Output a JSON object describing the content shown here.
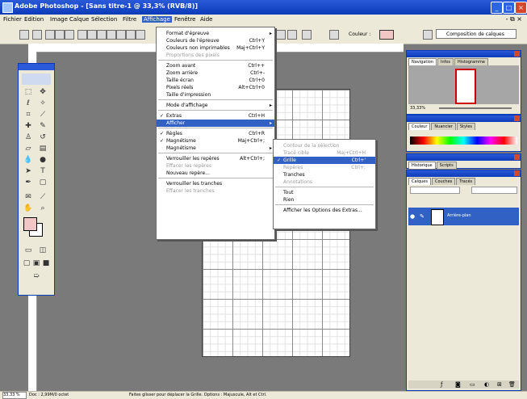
{
  "window": {
    "title": "Adobe Photoshop - [Sans titre-1 @ 33,3% (RVB/8)]"
  },
  "menubar": {
    "items": [
      "Fichier",
      "Edition",
      "Image",
      "Calque",
      "Sélection",
      "Filtre",
      "Affichage",
      "Fenêtre",
      "Aide"
    ],
    "active_index": 6
  },
  "options_bar": {
    "workspace_label": "Composition de calques",
    "fill_label": "Couleur :",
    "fill_color": "#f3c6c6"
  },
  "view_menu": {
    "items": [
      {
        "label": "Format d'épreuve",
        "shortcut": "",
        "submenu": true,
        "disabled": false,
        "checked": false
      },
      {
        "label": "Couleurs de l'épreuve",
        "shortcut": "Ctrl+Y",
        "submenu": false,
        "disabled": false,
        "checked": false
      },
      {
        "label": "Couleurs non imprimables",
        "shortcut": "Maj+Ctrl+Y",
        "submenu": false,
        "disabled": false,
        "checked": false
      },
      {
        "label": "Proportions des pixels",
        "shortcut": "",
        "submenu": false,
        "disabled": true,
        "checked": false
      },
      {
        "label": "Zoom avant",
        "shortcut": "Ctrl++",
        "submenu": false,
        "disabled": false,
        "checked": false
      },
      {
        "label": "Zoom arrière",
        "shortcut": "Ctrl+-",
        "submenu": false,
        "disabled": false,
        "checked": false
      },
      {
        "label": "Taille écran",
        "shortcut": "Ctrl+0",
        "submenu": false,
        "disabled": false,
        "checked": false
      },
      {
        "label": "Pixels réels",
        "shortcut": "Alt+Ctrl+0",
        "submenu": false,
        "disabled": false,
        "checked": false
      },
      {
        "label": "Taille d'impression",
        "shortcut": "",
        "submenu": false,
        "disabled": false,
        "checked": false
      },
      {
        "label": "Mode d'affichage",
        "shortcut": "",
        "submenu": true,
        "disabled": false,
        "checked": false
      },
      {
        "label": "Extras",
        "shortcut": "Ctrl+H",
        "submenu": false,
        "disabled": false,
        "checked": true
      },
      {
        "label": "Afficher",
        "shortcut": "",
        "submenu": true,
        "disabled": false,
        "checked": false,
        "selected": true
      },
      {
        "label": "Règles",
        "shortcut": "Ctrl+R",
        "submenu": false,
        "disabled": false,
        "checked": true
      },
      {
        "label": "Magnétisme",
        "shortcut": "Maj+Ctrl+;",
        "submenu": false,
        "disabled": false,
        "checked": true
      },
      {
        "label": "Magnétisme",
        "shortcut": "",
        "submenu": true,
        "disabled": false,
        "checked": false
      },
      {
        "label": "Verrouiller les repères",
        "shortcut": "Alt+Ctrl+;",
        "submenu": false,
        "disabled": false,
        "checked": false
      },
      {
        "label": "Effacer les repères",
        "shortcut": "",
        "submenu": false,
        "disabled": true,
        "checked": false
      },
      {
        "label": "Nouveau repère...",
        "shortcut": "",
        "submenu": false,
        "disabled": false,
        "checked": false
      },
      {
        "label": "Verrouiller les tranches",
        "shortcut": "",
        "submenu": false,
        "disabled": false,
        "checked": false
      },
      {
        "label": "Effacer les tranches",
        "shortcut": "",
        "submenu": false,
        "disabled": true,
        "checked": false
      }
    ]
  },
  "show_submenu": {
    "items": [
      {
        "label": "Contour de la sélection",
        "shortcut": "",
        "disabled": true,
        "checked": false
      },
      {
        "label": "Tracé cible",
        "shortcut": "Maj+Ctrl+H",
        "disabled": true,
        "checked": false
      },
      {
        "label": "Grille",
        "shortcut": "Ctrl+'",
        "disabled": false,
        "checked": true,
        "selected": true
      },
      {
        "label": "Repères",
        "shortcut": "Ctrl+;",
        "disabled": true,
        "checked": false
      },
      {
        "label": "Tranches",
        "shortcut": "",
        "disabled": false,
        "checked": false
      },
      {
        "label": "Annotations",
        "shortcut": "",
        "disabled": true,
        "checked": false
      },
      {
        "label": "Tout",
        "shortcut": "",
        "disabled": false,
        "checked": false
      },
      {
        "label": "Rien",
        "shortcut": "",
        "disabled": false,
        "checked": false
      },
      {
        "label": "Afficher les Options des Extras...",
        "shortcut": "",
        "disabled": false,
        "checked": false
      }
    ]
  },
  "panels": {
    "navigator": {
      "tabs": [
        "Navigation",
        "Infos",
        "Histogramme"
      ],
      "zoom": "33,33%"
    },
    "color": {
      "tabs": [
        "Couleur",
        "Nuancier",
        "Styles"
      ]
    },
    "history": {
      "tabs": [
        "Historique",
        "Scripts"
      ]
    },
    "layers": {
      "tabs": [
        "Calques",
        "Couches",
        "Tracés"
      ],
      "layer_name": "Arrière-plan"
    }
  },
  "status_bar": {
    "zoom": "33,33 %",
    "doc": "Doc : 2,99M/0 octet",
    "hint": "Faites glisser pour déplacer la Grille. Options : Majuscule, Alt et Ctrl."
  },
  "colors": {
    "titlebar": "#0b3bb8",
    "highlight": "#3161c5",
    "canvas_bg": "#7a7a7a",
    "foreground_swatch": "#f3c6c6"
  }
}
